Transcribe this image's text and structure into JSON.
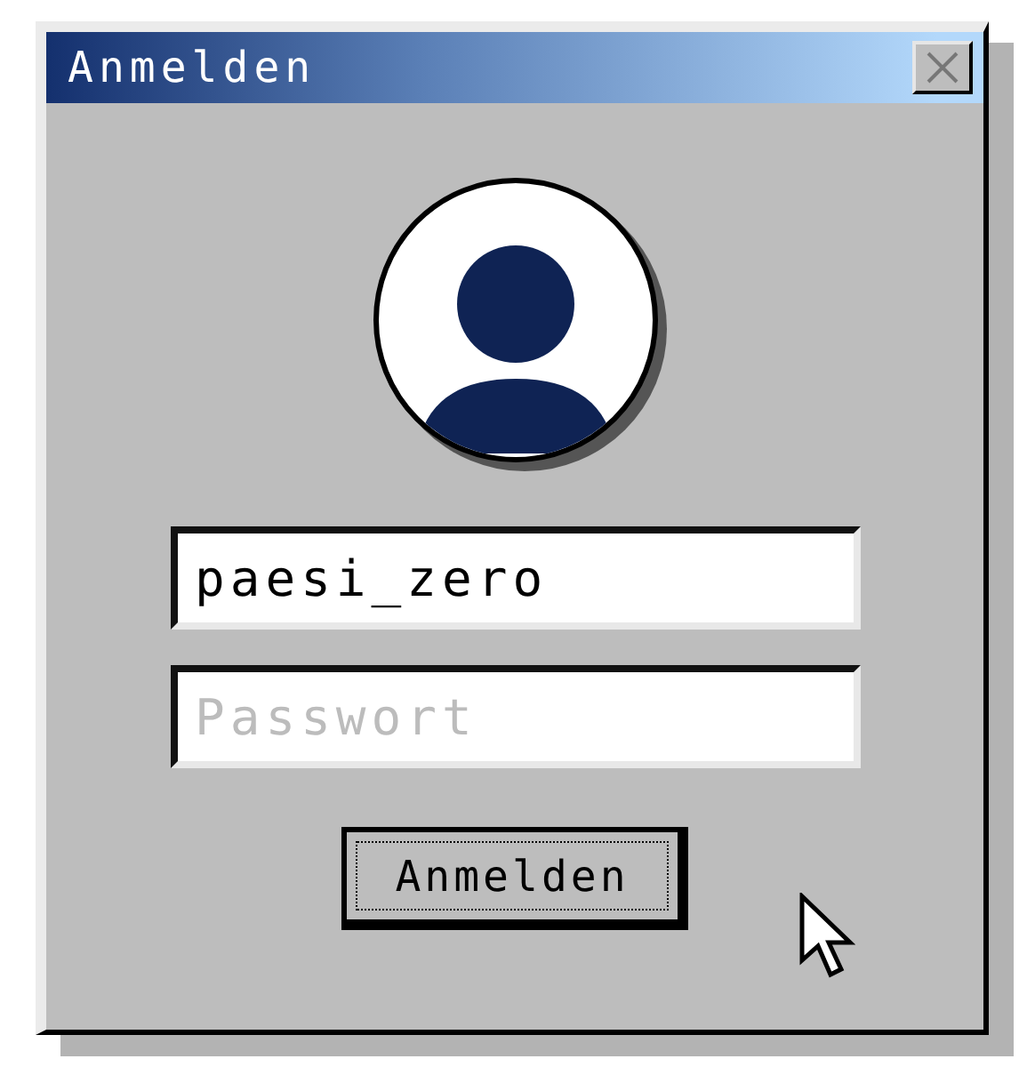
{
  "window": {
    "title": "Anmelden"
  },
  "username": {
    "value": "paesi_zero"
  },
  "password": {
    "placeholder": "Passwort"
  },
  "button": {
    "label": "Anmelden",
    "focused": true
  }
}
